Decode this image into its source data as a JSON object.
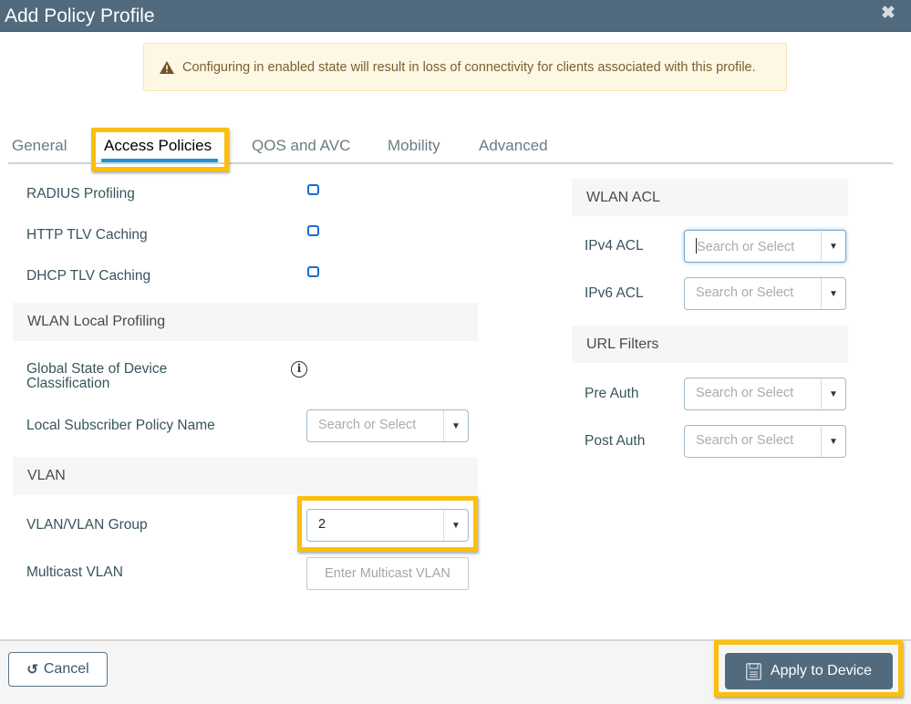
{
  "window": {
    "title": "Add Policy Profile",
    "close_icon": "close-icon"
  },
  "alert": {
    "icon": "warning-triangle-icon",
    "message": "Configuring in enabled state will result in loss of connectivity for clients associated with this profile."
  },
  "tabs": [
    {
      "label": "General",
      "active": false
    },
    {
      "label": "Access Policies",
      "active": true
    },
    {
      "label": "QOS and AVC",
      "active": false
    },
    {
      "label": "Mobility",
      "active": false
    },
    {
      "label": "Advanced",
      "active": false
    }
  ],
  "left": {
    "checkboxes": [
      {
        "label": "RADIUS Profiling",
        "checked": false
      },
      {
        "label": "HTTP TLV Caching",
        "checked": false
      },
      {
        "label": "DHCP TLV Caching",
        "checked": false
      }
    ],
    "wlan_local_profiling": {
      "heading": "WLAN Local Profiling",
      "global_state_label": "Global State of Device Classification",
      "global_state_icon": "info-icon",
      "local_subscriber_label": "Local Subscriber Policy Name",
      "local_subscriber_placeholder": "Search or Select"
    },
    "vlan": {
      "heading": "VLAN",
      "vlan_group_label": "VLAN/VLAN Group",
      "vlan_group_value": "2",
      "multicast_label": "Multicast VLAN",
      "multicast_placeholder": "Enter Multicast VLAN"
    }
  },
  "right": {
    "wlan_acl": {
      "heading": "WLAN ACL",
      "ipv4_label": "IPv4 ACL",
      "ipv4_placeholder": "Search or Select",
      "ipv6_label": "IPv6 ACL",
      "ipv6_placeholder": "Search or Select"
    },
    "url_filters": {
      "heading": "URL Filters",
      "pre_auth_label": "Pre Auth",
      "pre_auth_placeholder": "Search or Select",
      "post_auth_label": "Post Auth",
      "post_auth_placeholder": "Search or Select"
    }
  },
  "footer": {
    "cancel_label": "Cancel",
    "cancel_icon": "undo-icon",
    "apply_label": "Apply to Device",
    "apply_icon": "save-icon"
  },
  "colors": {
    "titlebar": "#526a7d",
    "highlight": "#fbbf0e",
    "tab_underline": "#1d94d4",
    "checkbox": "#1b6bd0",
    "alert_bg": "#fdf7e3"
  }
}
